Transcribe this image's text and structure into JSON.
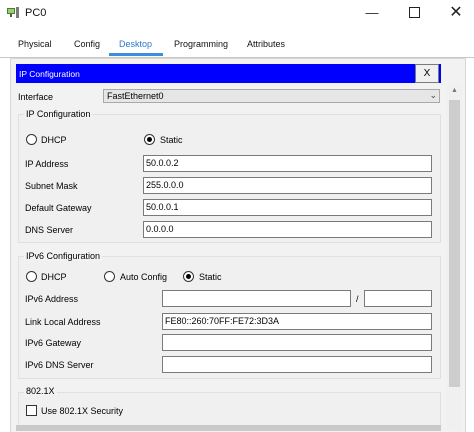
{
  "window": {
    "title": "PC0",
    "close_glyph": "✕",
    "minimize_glyph": "—"
  },
  "tabs": [
    "Physical",
    "Config",
    "Desktop",
    "Programming",
    "Attributes"
  ],
  "active_tab": "Desktop",
  "ip_config": {
    "title": "IP Configuration",
    "close_label": "X",
    "interface_label": "Interface",
    "interface_value": "FastEthernet0",
    "ipv4": {
      "section_label": "IP Configuration",
      "dhcp_label": "DHCP",
      "static_label": "Static",
      "selected_mode": "Static",
      "ip_address_label": "IP Address",
      "ip_address": "50.0.0.2",
      "subnet_mask_label": "Subnet Mask",
      "subnet_mask": "255.0.0.0",
      "default_gateway_label": "Default Gateway",
      "default_gateway": "50.0.0.1",
      "dns_server_label": "DNS Server",
      "dns_server": "0.0.0.0"
    },
    "ipv6": {
      "section_label": "IPv6 Configuration",
      "dhcp_label": "DHCP",
      "auto_config_label": "Auto Config",
      "static_label": "Static",
      "selected_mode": "Static",
      "address_label": "IPv6 Address",
      "address": "",
      "prefix_separator": "/",
      "prefix": "",
      "link_local_label": "Link Local Address",
      "link_local": "FE80::260:70FF:FE72:3D3A",
      "gateway_label": "IPv6 Gateway",
      "gateway": "",
      "dns_label": "IPv6 DNS Server",
      "dns": ""
    },
    "dot1x": {
      "section_label": "802.1X",
      "use_security_label": "Use 802.1X Security",
      "use_security": false
    }
  },
  "colors": {
    "header_bar": "#0000ff",
    "active_tab": "#2c7ac9"
  },
  "icons": {
    "app": "pc-app-icon",
    "scroll_up": "scroll-up-arrow-icon",
    "scroll_down": "scroll-down-arrow-icon"
  }
}
